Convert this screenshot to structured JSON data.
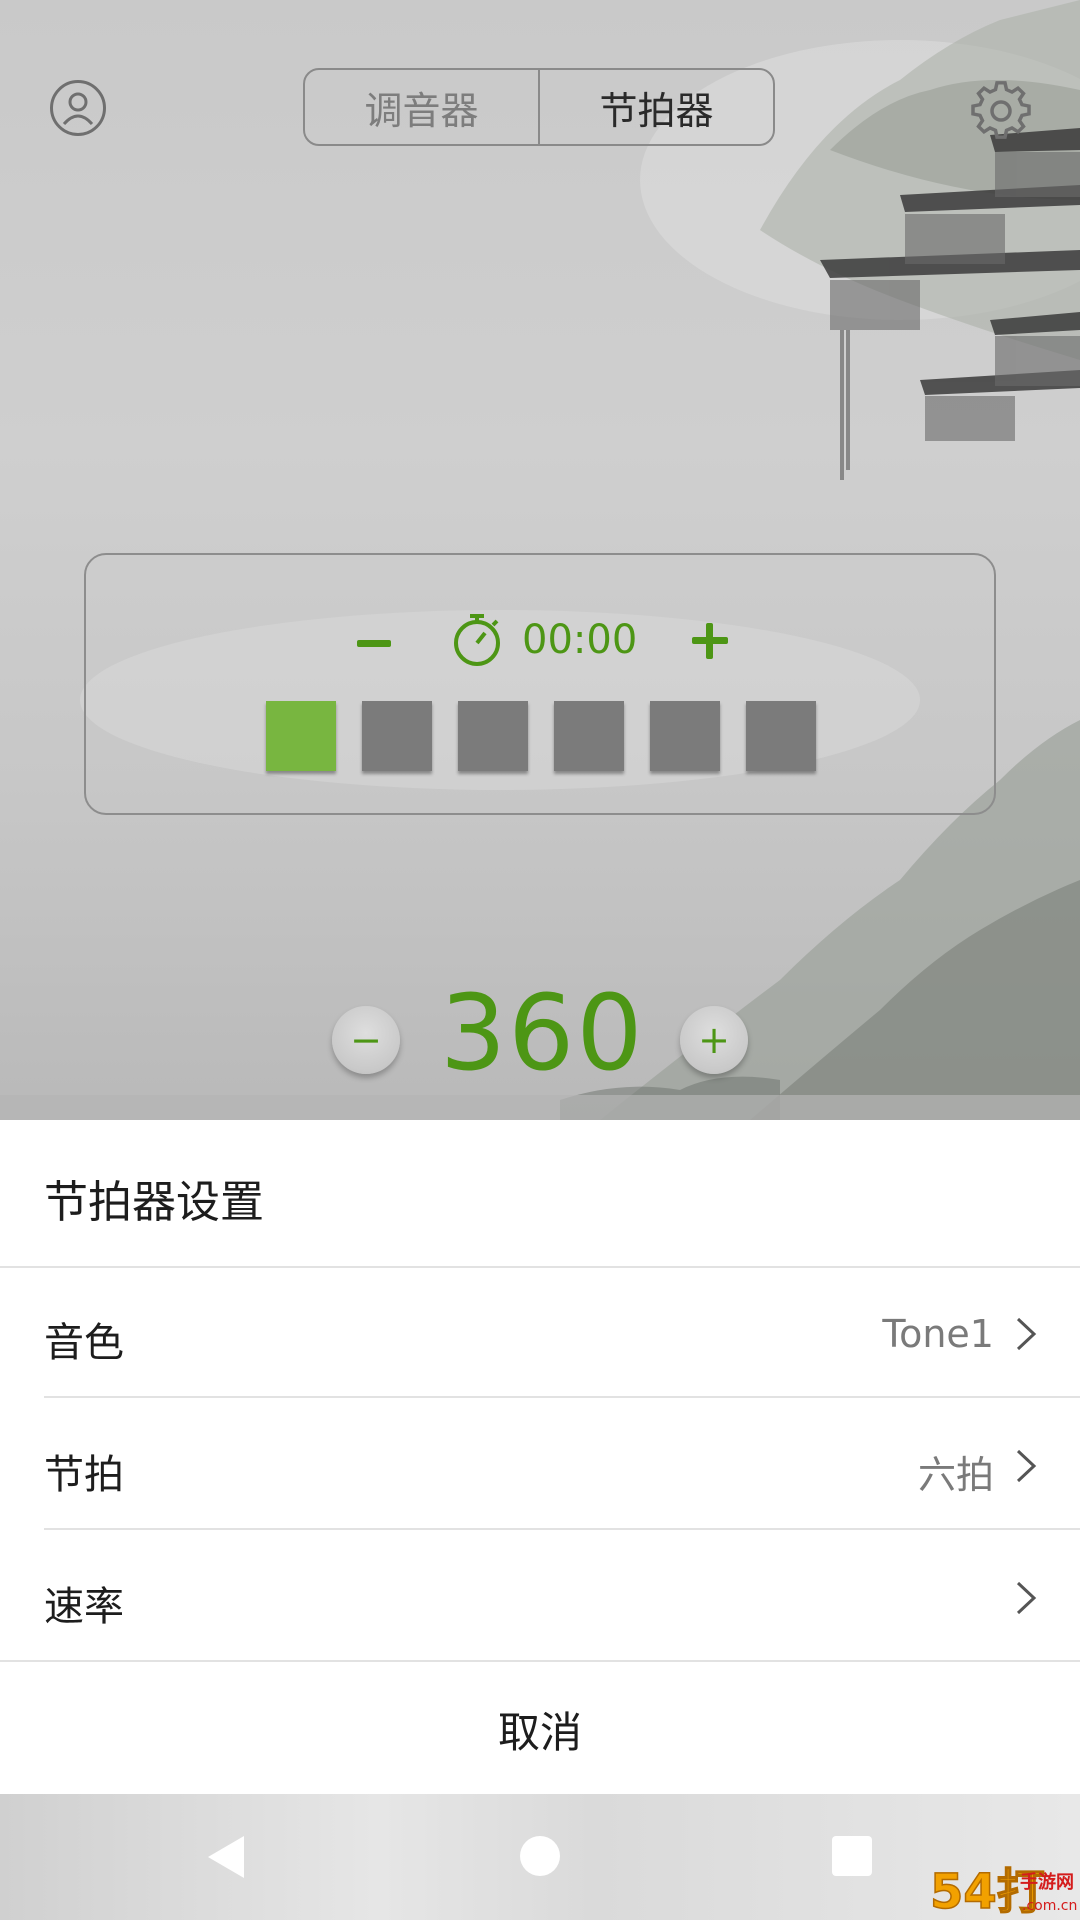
{
  "header": {
    "tabs": [
      {
        "label": "调音器",
        "active": false
      },
      {
        "label": "节拍器",
        "active": true
      }
    ],
    "profile_icon": "user-circle-icon",
    "settings_icon": "gear-icon"
  },
  "metronome": {
    "timer": "00:00",
    "beats_total": 6,
    "active_beat": 1,
    "bpm": "360",
    "bpm_minus": "−",
    "bpm_plus": "+"
  },
  "sheet": {
    "title": "节拍器设置",
    "rows": [
      {
        "label": "音色",
        "value": "Tone1"
      },
      {
        "label": "节拍",
        "value": "六拍"
      },
      {
        "label": "速率",
        "value": ""
      }
    ],
    "cancel": "取消"
  },
  "watermark": {
    "text": "54打",
    "sub1": "手游网",
    "sub2": ".com.cn"
  },
  "colors": {
    "accent": "#4d9615",
    "beat_active": "#78b640",
    "beat_inactive": "#7b7b7b"
  }
}
